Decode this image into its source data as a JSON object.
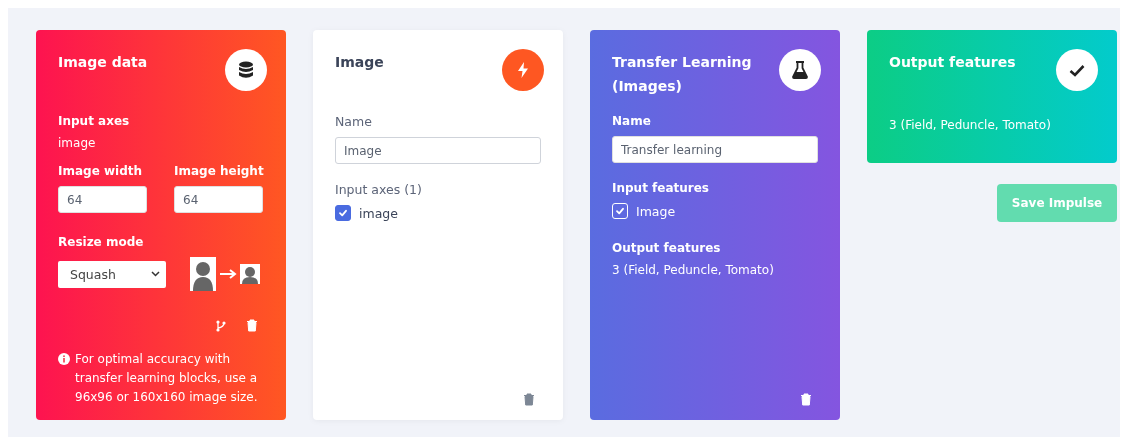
{
  "image_data": {
    "title": "Image data",
    "input_axes_label": "Input axes",
    "input_axes_value": "image",
    "width_label": "Image width",
    "width_value": "64",
    "height_label": "Image height",
    "height_value": "64",
    "resize_label": "Resize mode",
    "resize_value": "Squash",
    "note": "For optimal accuracy with transfer learning blocks, use a 96x96 or 160x160 image size."
  },
  "processing": {
    "title": "Image",
    "name_label": "Name",
    "name_value": "Image",
    "axes_label": "Input axes (1)",
    "axes": [
      {
        "label": "image",
        "checked": true
      }
    ]
  },
  "learning": {
    "title": "Transfer Learning (Images)",
    "name_label": "Name",
    "name_value": "Transfer learning",
    "input_label": "Input features",
    "inputs": [
      {
        "label": "Image",
        "checked": true
      }
    ],
    "output_label": "Output features",
    "output_value": "3 (Field, Peduncle, Tomato)"
  },
  "output": {
    "title": "Output features",
    "value": "3 (Field, Peduncle, Tomato)"
  },
  "save_button": {
    "label": "Save Impulse",
    "disabled": true
  }
}
